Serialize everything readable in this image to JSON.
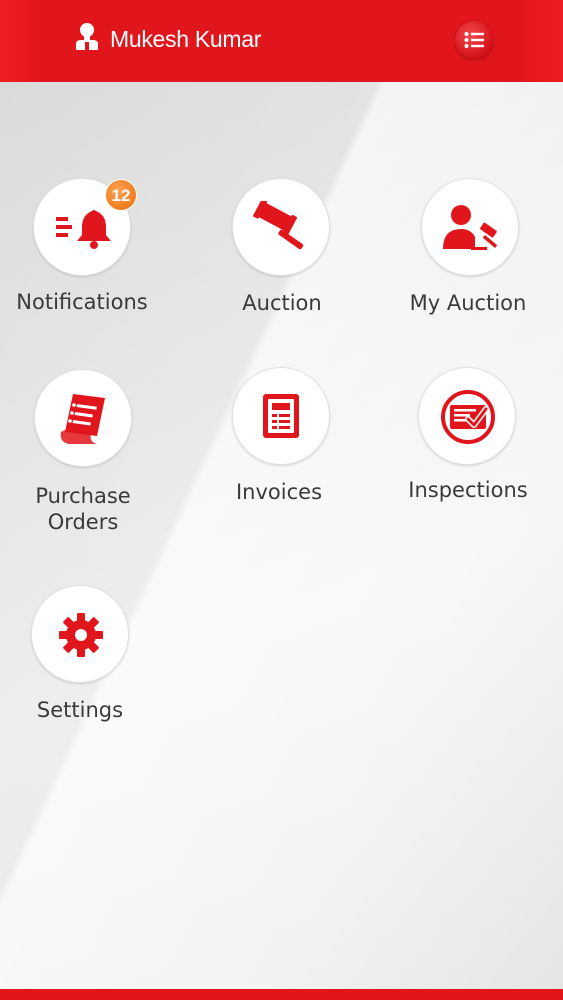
{
  "header": {
    "user_name": "Mukesh Kumar",
    "user_icon": "user-icon",
    "menu_icon": "list-menu-icon",
    "accent": "#e1161c"
  },
  "tiles": [
    {
      "label": "Notifications",
      "icon": "bell-icon",
      "badge": "12"
    },
    {
      "label": "Auction",
      "icon": "gavel-icon"
    },
    {
      "label": "My Auction",
      "icon": "user-gavel-icon"
    },
    {
      "label_lines": [
        "Purchase",
        "Orders"
      ],
      "icon": "document-scroll-icon"
    },
    {
      "label": "Invoices",
      "icon": "invoice-icon"
    },
    {
      "label": "Inspections",
      "icon": "inspection-check-icon"
    },
    {
      "label": "Settings",
      "icon": "gear-icon"
    }
  ],
  "colors": {
    "icon_red": "#e1161c",
    "badge_orange": "#f07d1d",
    "label_gray": "#3a3a3a"
  }
}
